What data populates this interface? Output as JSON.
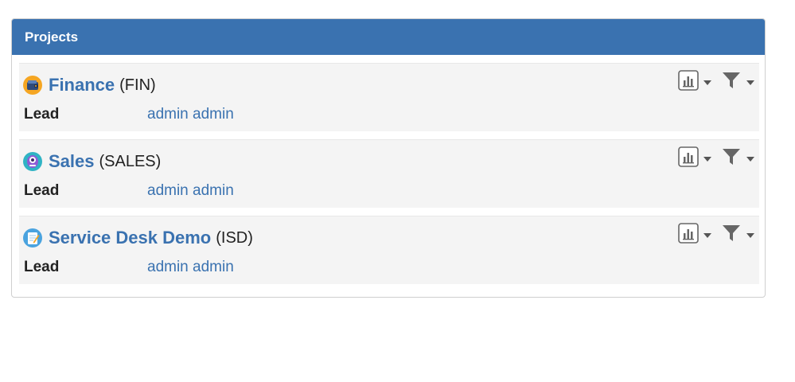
{
  "panel": {
    "title": "Projects"
  },
  "projects": [
    {
      "name": "Finance",
      "key": "(FIN)",
      "lead_label": "Lead",
      "lead_value": "admin admin",
      "icon": "wallet-icon",
      "icon_color": "#f5a623"
    },
    {
      "name": "Sales",
      "key": "(SALES)",
      "lead_label": "Lead",
      "lead_value": "admin admin",
      "icon": "robot-icon",
      "icon_color": "#2fb3c4"
    },
    {
      "name": "Service Desk Demo",
      "key": "(ISD)",
      "lead_label": "Lead",
      "lead_value": "admin admin",
      "icon": "notepad-icon",
      "icon_color": "#4aa3df"
    }
  ],
  "colors": {
    "header_bg": "#3a72b0",
    "link": "#3a72b0",
    "row_bg": "#f4f4f4"
  }
}
